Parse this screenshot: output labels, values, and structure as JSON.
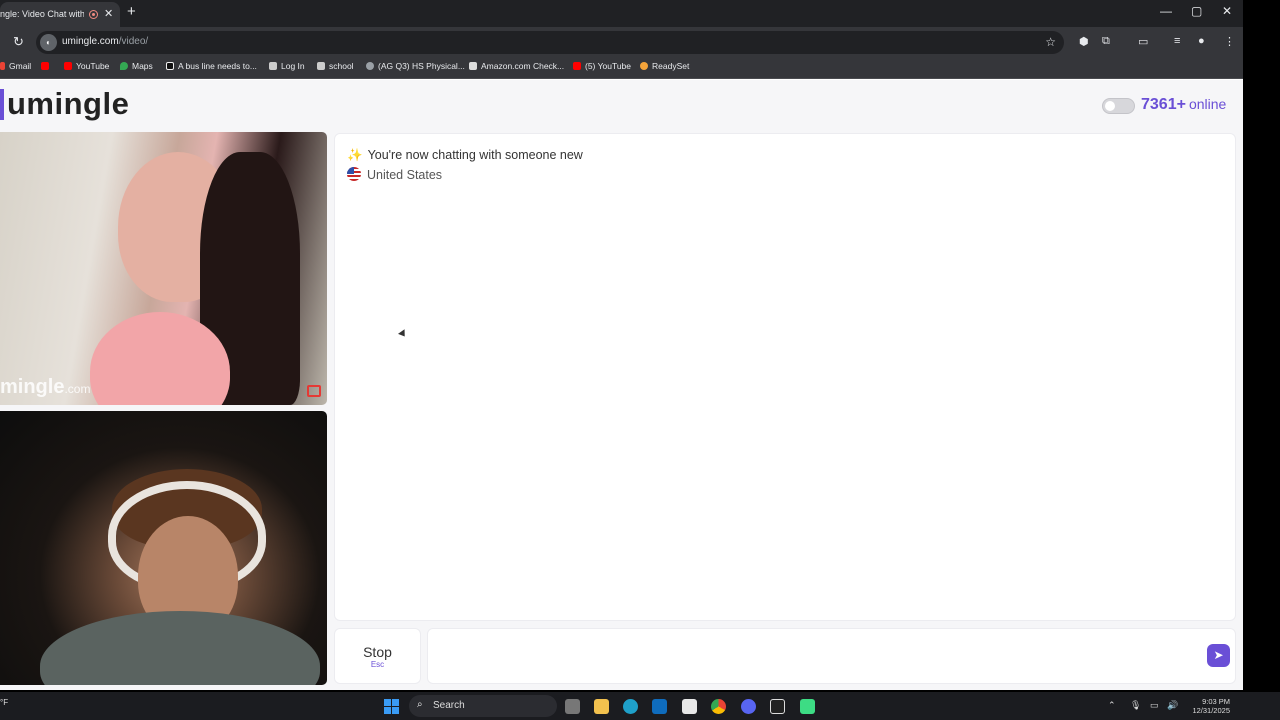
{
  "browser": {
    "tab_title": "ngle: Video Chat with S",
    "tab_close": "✕",
    "new_tab": "+",
    "window_controls": {
      "minimize": "—",
      "maximize": "▢",
      "close": "✕"
    },
    "reload": "↻",
    "url_host": "umingle.com",
    "url_path": "/video/",
    "bookmarks": [
      {
        "label": "Gmail",
        "color": "#ea4335"
      },
      {
        "label": "",
        "color": "#ff0000"
      },
      {
        "label": "YouTube",
        "color": "#ff0000"
      },
      {
        "label": "Maps",
        "color": "#34a853"
      },
      {
        "label": "A bus line needs to...",
        "color": "#222222"
      },
      {
        "label": "Log In",
        "color": "#cccccc"
      },
      {
        "label": "school",
        "color": "#cccccc"
      },
      {
        "label": "(AG Q3) HS Physical...",
        "color": "#9aa0a6"
      },
      {
        "label": "Amazon.com Check...",
        "color": "#dddddd"
      },
      {
        "label": "(5) YouTube",
        "color": "#ff0000"
      },
      {
        "label": "ReadySet",
        "color": "#f4a43a"
      }
    ]
  },
  "page": {
    "logo": "umingle",
    "online_count": "7361+",
    "online_label": "online",
    "video_watermark": "mingle",
    "video_watermark_domain": ".com",
    "chat": {
      "status": "You're now chatting with someone new",
      "country": "United States"
    },
    "stop_label": "Stop",
    "stop_key": "Esc",
    "message_value": "",
    "accent_color": "#6a4fd6"
  },
  "taskbar": {
    "weather": "°F",
    "search_label": "Search",
    "time": "9:03 PM",
    "date": "12/31/2025"
  }
}
